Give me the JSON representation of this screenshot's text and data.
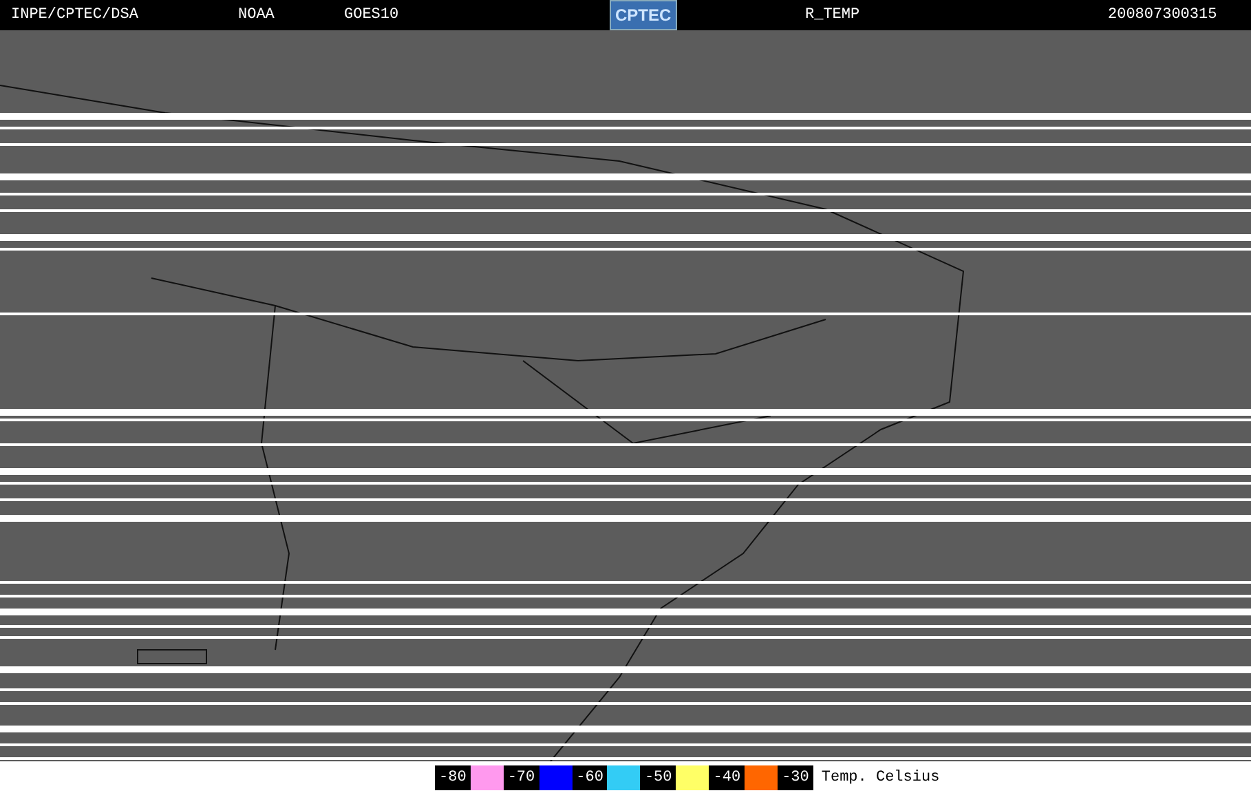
{
  "header": {
    "items": [
      {
        "kind": "text",
        "text": "INPE/CPTEC/DSA"
      },
      {
        "kind": "text",
        "text": "NOAA"
      },
      {
        "kind": "text",
        "text": "GOES10"
      },
      {
        "kind": "logo",
        "text": "CPTEC"
      },
      {
        "kind": "text",
        "text": "R_TEMP"
      },
      {
        "kind": "text",
        "text": "200807300315"
      }
    ]
  },
  "legend": {
    "entries": [
      {
        "label": "-80",
        "color": "#ff99ee"
      },
      {
        "label": "-70",
        "color": "#0000ff"
      },
      {
        "label": "-60",
        "color": "#33ccf5"
      },
      {
        "label": "-50",
        "color": "#ffff66"
      },
      {
        "label": "-40",
        "color": "#ff6600"
      },
      {
        "label": "-30"
      }
    ],
    "unit": "Temp. Celsius"
  }
}
